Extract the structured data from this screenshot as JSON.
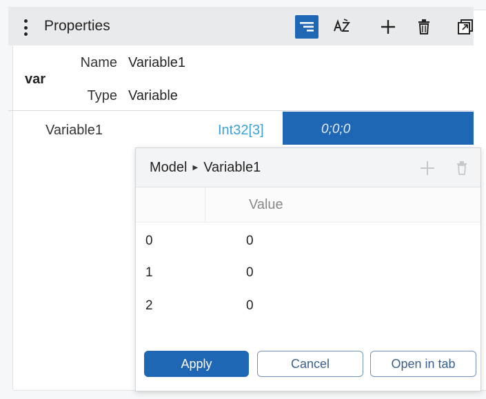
{
  "panel": {
    "title": "Properties",
    "toolbar": {
      "filter_icon": "filter-icon",
      "sort_icon": "sort-az-icon",
      "add_icon": "add-icon",
      "delete_icon": "trash-icon",
      "popout_icon": "popout-icon"
    }
  },
  "var_section": {
    "label": "var",
    "name_key": "Name",
    "name_value": "Variable1",
    "type_key": "Type",
    "type_value": "Variable"
  },
  "variable_row": {
    "name": "Variable1",
    "type": "Int32[3]",
    "value": "0;0;0"
  },
  "editor": {
    "breadcrumb": [
      "Model",
      "Variable1"
    ],
    "column_header": "Value",
    "rows": [
      {
        "index": "0",
        "value": "0"
      },
      {
        "index": "1",
        "value": "0"
      },
      {
        "index": "2",
        "value": "0"
      }
    ],
    "buttons": {
      "apply": "Apply",
      "cancel": "Cancel",
      "open_in_tab": "Open in tab"
    }
  },
  "colors": {
    "accent": "#1f66b5",
    "type_text": "#3aa0d8",
    "header_bg": "#e9eaec"
  }
}
